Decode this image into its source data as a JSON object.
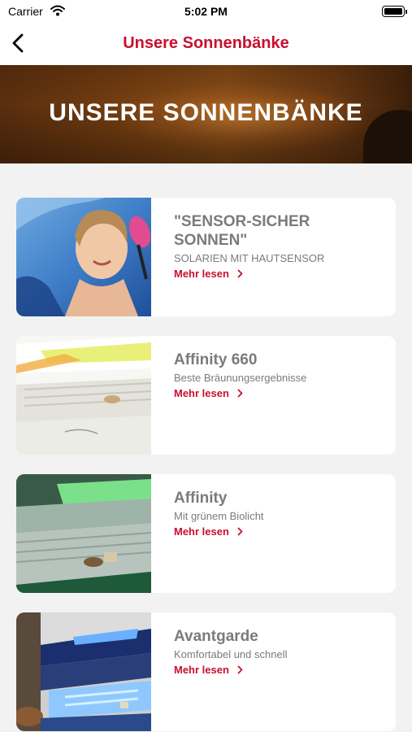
{
  "status_bar": {
    "carrier": "Carrier",
    "time": "5:02 PM"
  },
  "nav": {
    "title": "Unsere Sonnenbänke"
  },
  "hero": {
    "title": "UNSERE SONNENBÄNKE"
  },
  "cards": [
    {
      "title": "\"SENSOR-SICHER SONNEN\"",
      "subtitle": "SOLARIEN MIT HAUTSENSOR",
      "link": "Mehr lesen"
    },
    {
      "title": "Affinity 660",
      "subtitle": "Beste Bräunungsergebnisse",
      "link": "Mehr lesen"
    },
    {
      "title": "Affinity",
      "subtitle": "Mit grünem Biolicht",
      "link": "Mehr lesen"
    },
    {
      "title": "Avantgarde",
      "subtitle": "Komfortabel und schnell",
      "link": "Mehr lesen"
    }
  ],
  "colors": {
    "accent": "#c8102e",
    "text_muted": "#7b7b7b",
    "background": "#f2f2f2"
  },
  "icons": {
    "back": "chevron-left-icon",
    "link": "chevron-right-icon",
    "wifi": "wifi-icon",
    "battery": "battery-icon"
  }
}
